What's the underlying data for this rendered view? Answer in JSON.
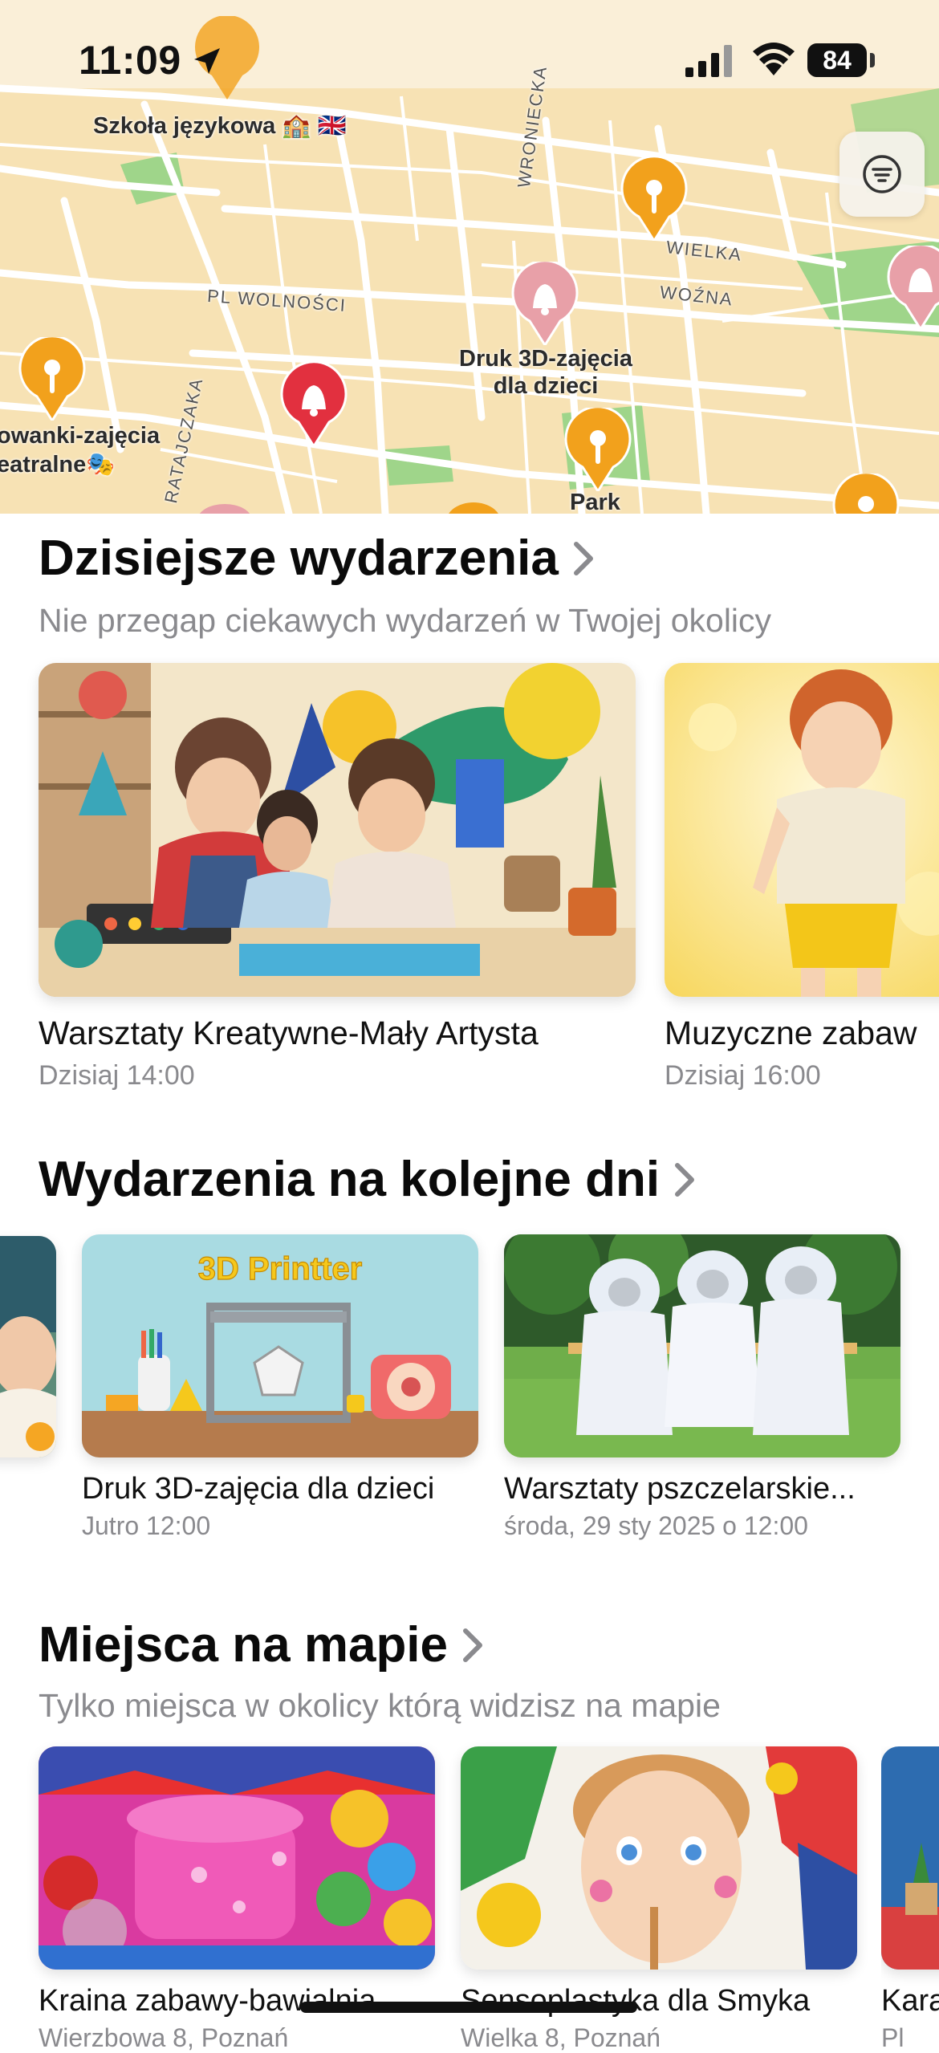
{
  "status_bar": {
    "time": "11:09",
    "battery": "84"
  },
  "map": {
    "labels": {
      "school": "Szkoła językowa 🏫 🇬🇧",
      "wolnosci": "PL WOLNOŚCI",
      "wroniecka": "WRONIECKA",
      "wielka": "WIELKA",
      "wozna": "WOŹNA",
      "ratajczaka": "RATAJCZAKA",
      "druk": "Druk 3D-zajęcia\ndla dzieci",
      "teatr": "owanki-zajęcia\neatralne🎭",
      "park": "Park"
    },
    "colors": {
      "pin_orange": "#f2a11c",
      "pin_red": "#e2303f",
      "pin_pink": "#e8a0a8",
      "park_green": "#9fd58a"
    }
  },
  "sections": {
    "today": {
      "title": "Dzisiejsze wydarzenia",
      "subtitle": "Nie przegap ciekawych wydarzeń w Twojej okolicy",
      "cards": [
        {
          "title": "Warsztaty Kreatywne-Mały Artysta",
          "meta": "Dzisiaj 14:00"
        },
        {
          "title": "Muzyczne zabaw",
          "meta": "Dzisiaj 16:00"
        }
      ]
    },
    "upcoming": {
      "title": "Wydarzenia na kolejne dni",
      "cards": [
        {
          "title": "Druk 3D-zajęcia dla dzieci",
          "meta": "Jutro 12:00",
          "image_text": "3D Printter"
        },
        {
          "title": "Warsztaty pszczelarskie...",
          "meta": "środa, 29 sty 2025 o 12:00"
        }
      ]
    },
    "places": {
      "title": "Miejsca na mapie",
      "subtitle": "Tylko miejsca w okolicy którą widzisz na mapie",
      "cards": [
        {
          "title": "Kraina zabawy-bawialnia",
          "meta": "Wierzbowa 8, Poznań"
        },
        {
          "title": "Sensoplastyka dla Smyka",
          "meta": "Wielka 8, Poznań"
        },
        {
          "title": "Kara",
          "meta": "Pl"
        }
      ]
    }
  }
}
